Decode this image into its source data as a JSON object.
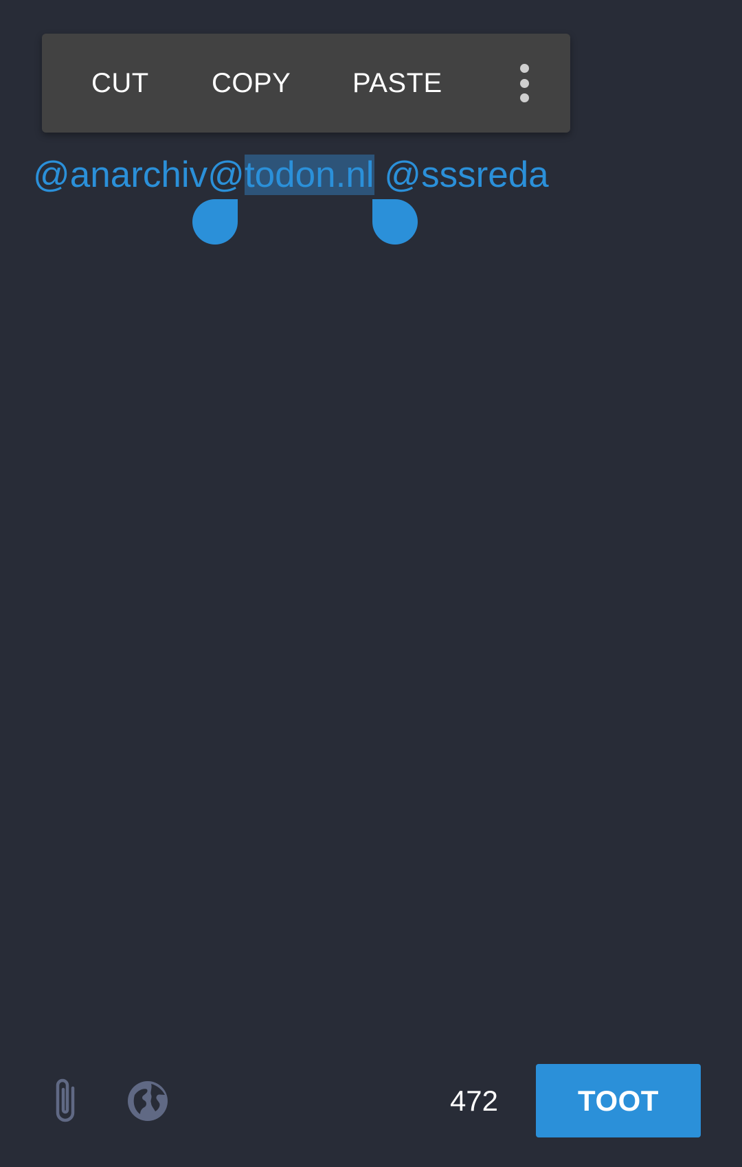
{
  "colors": {
    "background": "#282c37",
    "toolbar_background": "#424242",
    "accent": "#2b90d9",
    "selection_highlight": "#2d5479",
    "icon_muted": "#606984"
  },
  "selection_toolbar": {
    "cut_label": "CUT",
    "copy_label": "COPY",
    "paste_label": "PASTE",
    "overflow_icon": "more-vert-icon"
  },
  "compose": {
    "text_before_selection": "@anarchiv@",
    "selected_text": "todon.nl",
    "text_after_selection": " @sssreda"
  },
  "footer": {
    "attach_icon": "paperclip-icon",
    "visibility_icon": "globe-icon",
    "char_count": "472",
    "submit_label": "TOOT"
  }
}
